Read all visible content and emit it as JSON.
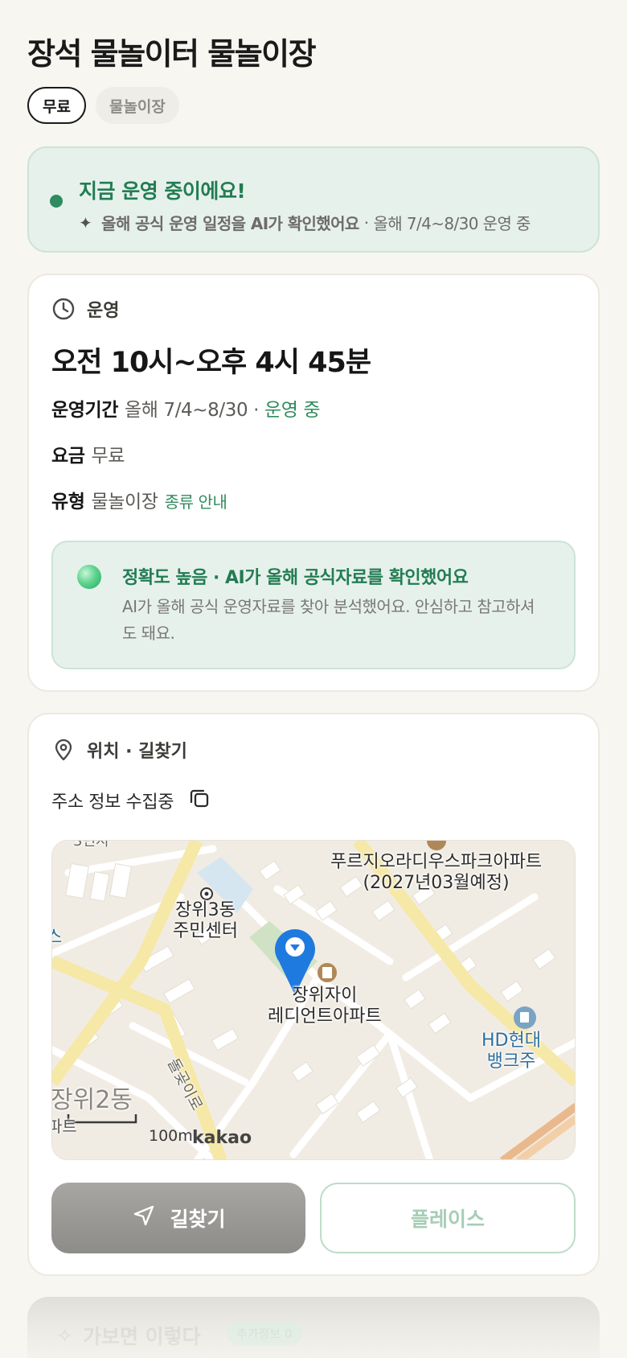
{
  "page": {
    "title": "장석 물놀이터 물놀이장"
  },
  "chips": [
    {
      "label": "무료"
    },
    {
      "label": "물놀이장"
    }
  ],
  "status": {
    "title": "지금 운영 중이에요!",
    "sparkle_icon": "sparkle-icon",
    "sub_strong": "올해 공식 운영 일정을 AI가 확인했어요",
    "sub_sep": "·",
    "sub_rest": "올해 7/4~8/30 운영 중",
    "accent_color": "#2e8c5f"
  },
  "operation": {
    "header": "운영",
    "header_icon": "clock-icon",
    "hours": "오전 10시~오후 4시 45분",
    "period_key": "운영기간",
    "period_value": "올해 7/4~8/30",
    "period_sep": "·",
    "period_status": "운영 중",
    "fee_key": "요금",
    "fee_value": "무료",
    "type_key": "유형",
    "type_value": "물놀이장",
    "type_link": "종류 안내",
    "accuracy_title": "정확도 높음 · AI가 올해 공식자료를 확인했어요",
    "accuracy_body": "AI가 올해 공식 운영자료를 찾아 분석했어요. 안심하고 참고하셔도 돼요."
  },
  "location": {
    "header": "위치 · 길찾기",
    "header_icon": "pin-icon",
    "address": "주소 정보 수집중",
    "copy_icon": "copy-icon",
    "map_labels": {
      "community_center": "장위3동\n주민센터",
      "apartment": "장위자이\n레디언트아파트",
      "park_apartment": "푸르지오라디우스파크아파트\n(2027년03월예정)",
      "hd_bank": "HD현대\n뱅크주",
      "district": "장위2동",
      "road": "돌곶이로",
      "top_edge": "3번지",
      "left_edge": "스",
      "left_bottom": "파트"
    },
    "scale": "100m",
    "kakao": "kakao",
    "route_button": "길찾기",
    "route_icon": "navigation-arrow-icon",
    "place_button": "플레이스"
  },
  "teaser": {
    "title": "가보면 이렇다",
    "badge": "추가정보 0",
    "icon": "sparkle-icon"
  }
}
